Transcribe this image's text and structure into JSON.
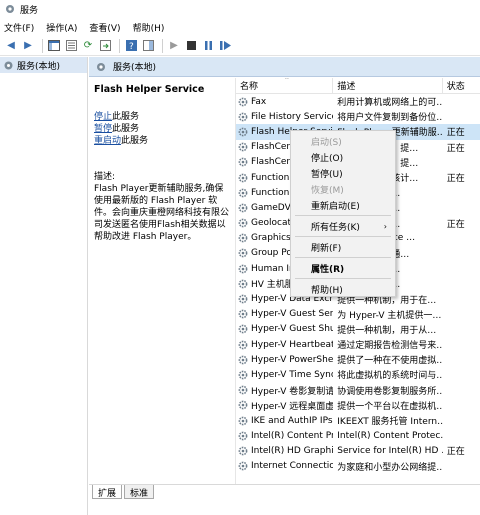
{
  "window": {
    "title": "服务"
  },
  "menubar": {
    "items": [
      "文件(F)",
      "操作(A)",
      "查看(V)",
      "帮助(H)"
    ]
  },
  "tree": {
    "item": "服务(本地)"
  },
  "content": {
    "header": "服务(本地)"
  },
  "details": {
    "service_name": "Flash Helper Service",
    "actions": [
      {
        "link": "停止",
        "rest": "此服务"
      },
      {
        "link": "暂停",
        "rest": "此服务"
      },
      {
        "link": "重启动",
        "rest": "此服务"
      }
    ],
    "description_label": "描述:",
    "description": "Flash Player更新辅助服务,确保使用最新版的 Flash Player 软件。会向重庆重橙网络科技有限公司发送匿名使用Flash相关数据以帮助改进 Flash Player。"
  },
  "list": {
    "columns": {
      "name": "名称",
      "description": "描述",
      "status": "状态"
    },
    "rows": [
      {
        "name": "Fax",
        "description": "利用计算机或网络上的可…",
        "status": ""
      },
      {
        "name": "File History Service",
        "description": "将用户文件复制到备份位…",
        "status": ""
      },
      {
        "name": "Flash Helper Service",
        "description": "Flash Player更新辅助服…",
        "status": "正在"
      },
      {
        "name": "FlashCenter",
        "description": "…的服务程序，提…",
        "status": "正在"
      },
      {
        "name": "FlashCenter…",
        "description": "…的服务程序，提…",
        "status": ""
      },
      {
        "name": "Function Dis…",
        "description": "…服务会发布该计…",
        "status": "正在"
      },
      {
        "name": "Function Dis…",
        "description": "…以及连接到…",
        "status": ""
      },
      {
        "name": "GameDVR…",
        "description": "…于游戏录制…",
        "status": ""
      },
      {
        "name": "Geolocation…",
        "description": "…系统的当前…",
        "status": "正在"
      },
      {
        "name": "Graphics Pe…",
        "description": "…Performance …",
        "status": ""
      },
      {
        "name": "Group Polic…",
        "description": "…应用管理员通…",
        "status": ""
      },
      {
        "name": "Human Inter…",
        "description": "…控器和其他…",
        "status": ""
      },
      {
        "name": "HV 主机服务",
        "description": "…虚拟机监控…",
        "status": ""
      },
      {
        "name": "Hyper-V Data Exch…",
        "description": "提供一种机制，用于在…",
        "status": ""
      },
      {
        "name": "Hyper-V Guest Ser…",
        "description": "为 Hyper-V 主机提供一…",
        "status": ""
      },
      {
        "name": "Hyper-V Guest Shu…",
        "description": "提供一种机制，用于从…",
        "status": ""
      },
      {
        "name": "Hyper-V Heartbeat…",
        "description": "通过定期报告检测信号来…",
        "status": ""
      },
      {
        "name": "Hyper-V PowerShel…",
        "description": "提供了一种在不使用虚拟…",
        "status": ""
      },
      {
        "name": "Hyper-V Time Sync…",
        "description": "将此虚拟机的系统时间与…",
        "status": ""
      },
      {
        "name": "Hyper-V 卷影复制请…",
        "description": "协调使用卷影复制服务所…",
        "status": ""
      },
      {
        "name": "Hyper-V 远程桌面虚…",
        "description": "提供一个平台以在虚拟机…",
        "status": ""
      },
      {
        "name": "IKE and AuthIP IPs…",
        "description": "IKEEXT 服务托管 Intern…",
        "status": ""
      },
      {
        "name": "Intel(R) Content Pr…",
        "description": "Intel(R) Content Protec…",
        "status": ""
      },
      {
        "name": "Intel(R) HD Graphic…",
        "description": "Service for Intel(R) HD …",
        "status": "正在"
      },
      {
        "name": "Internet Connectio…",
        "description": "为家庭和小型办公网络提…",
        "status": ""
      }
    ]
  },
  "tabs": [
    "扩展",
    "标准"
  ],
  "context_menu": {
    "start": "启动(S)",
    "stop": "停止(O)",
    "pause": "暂停(U)",
    "resume": "恢复(M)",
    "restart": "重新启动(E)",
    "all_tasks": "所有任务(K)",
    "refresh": "刷新(F)",
    "properties": "属性(R)",
    "help": "帮助(H)"
  }
}
